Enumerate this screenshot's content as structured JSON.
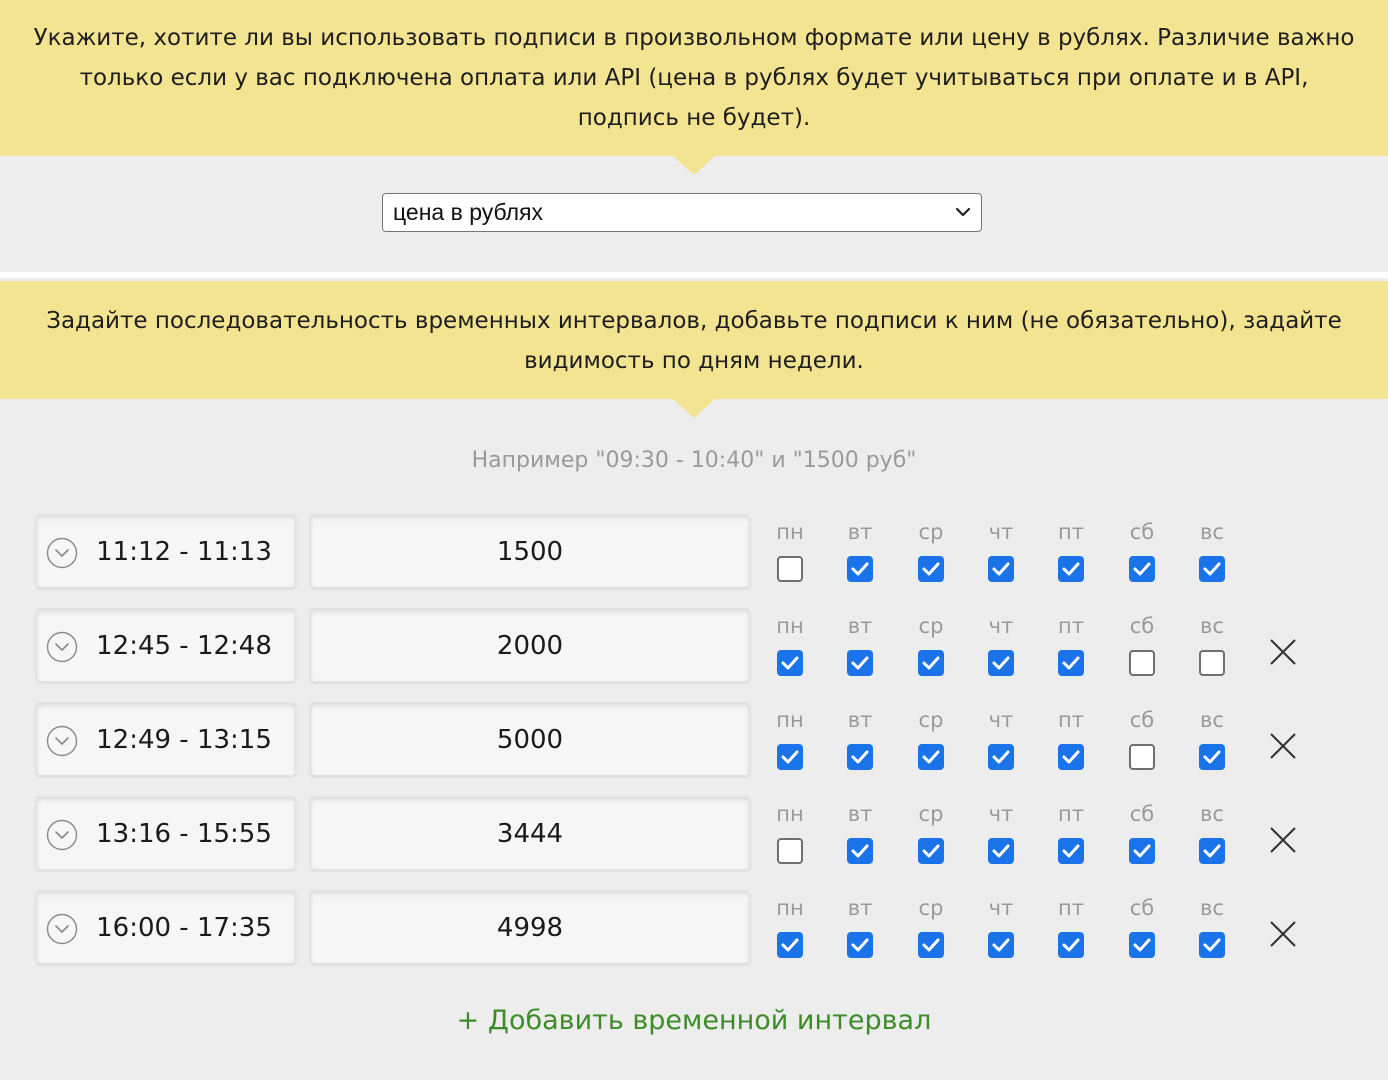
{
  "hint1": {
    "line1": "Укажите, хотите ли вы использовать подписи в произвольном формате или цену в рублях. Различие важно",
    "line2": "только если у вас подключена оплата или API (цена в рублях будет учитываться при оплате и в API,",
    "line3": "подпись не будет)."
  },
  "format_select": {
    "value": "цена в рублях",
    "icon": "chevron-down-icon"
  },
  "hint2": {
    "line1": "Задайте последовательность временных интервалов, добавьте подписи к ним (не обязательно), задайте",
    "line2": "видимость по дням недели."
  },
  "example": "Например \"09:30 - 10:40\" и \"1500 руб\"",
  "days": [
    "пн",
    "вт",
    "ср",
    "чт",
    "пт",
    "сб",
    "вс"
  ],
  "intervals": [
    {
      "time": "11:12 - 11:13",
      "label": "1500",
      "days": [
        false,
        true,
        true,
        true,
        true,
        true,
        true
      ],
      "removable": false
    },
    {
      "time": "12:45 - 12:48",
      "label": "2000",
      "days": [
        true,
        true,
        true,
        true,
        true,
        false,
        false
      ],
      "removable": true
    },
    {
      "time": "12:49 - 13:15",
      "label": "5000",
      "days": [
        true,
        true,
        true,
        true,
        true,
        false,
        true
      ],
      "removable": true
    },
    {
      "time": "13:16 - 15:55",
      "label": "3444",
      "days": [
        false,
        true,
        true,
        true,
        true,
        true,
        true
      ],
      "removable": true
    },
    {
      "time": "16:00 - 17:35",
      "label": "4998",
      "days": [
        true,
        true,
        true,
        true,
        true,
        true,
        true
      ],
      "removable": true
    }
  ],
  "add_interval_label": "+ Добавить временной интервал",
  "colors": {
    "hint_bg": "#f3e492",
    "page_bg": "#ededed",
    "checkbox_on": "#1a73e8",
    "add_link": "#3d8c28"
  }
}
